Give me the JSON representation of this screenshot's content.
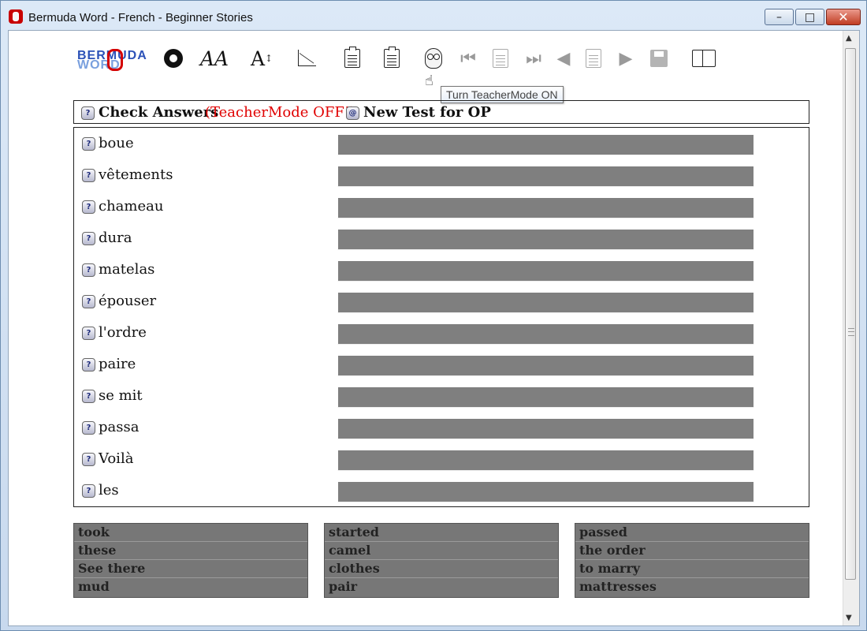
{
  "window": {
    "title": "Bermuda Word - French - Beginner Stories",
    "controls": {
      "minimize": "–",
      "maximize": "□",
      "close": "✕"
    }
  },
  "toolbar": {
    "logo_top": "BERMUDA",
    "logo_bottom": "WORD",
    "icons": [
      "settings-gear-icon",
      "font-style-icon",
      "font-size-icon",
      "graph-icon",
      "worksheet-icon",
      "quiz-icon",
      "owl-icon",
      "first-page-icon",
      "page-icon",
      "next-set-icon",
      "previous-icon",
      "page-number-icon",
      "next-icon",
      "save-icon",
      "book-icon"
    ],
    "labels": {
      "font_style": "AA",
      "font_size": "A",
      "question": "?"
    },
    "tooltip": "Turn TeacherMode ON"
  },
  "actions": {
    "check_answers": "Check Answers",
    "teacher_status": "(TeacherMode OFF!)",
    "new_test": "New Test for OP"
  },
  "questions": [
    "boue",
    "vêtements",
    "chameau",
    "dura",
    "matelas",
    "épouser",
    "l'ordre",
    "paire",
    "se mit",
    "passa",
    "Voilà",
    "les"
  ],
  "word_bank": [
    [
      "took",
      "these",
      "See there",
      "mud"
    ],
    [
      "started",
      "camel",
      "clothes",
      "pair"
    ],
    [
      "passed",
      "the order",
      "to marry",
      "mattresses"
    ]
  ],
  "icons": {
    "help": "question-badge-icon",
    "new_test": "at-sign-badge-icon"
  },
  "scrollbar": {
    "up": "▲",
    "down": "▼"
  }
}
